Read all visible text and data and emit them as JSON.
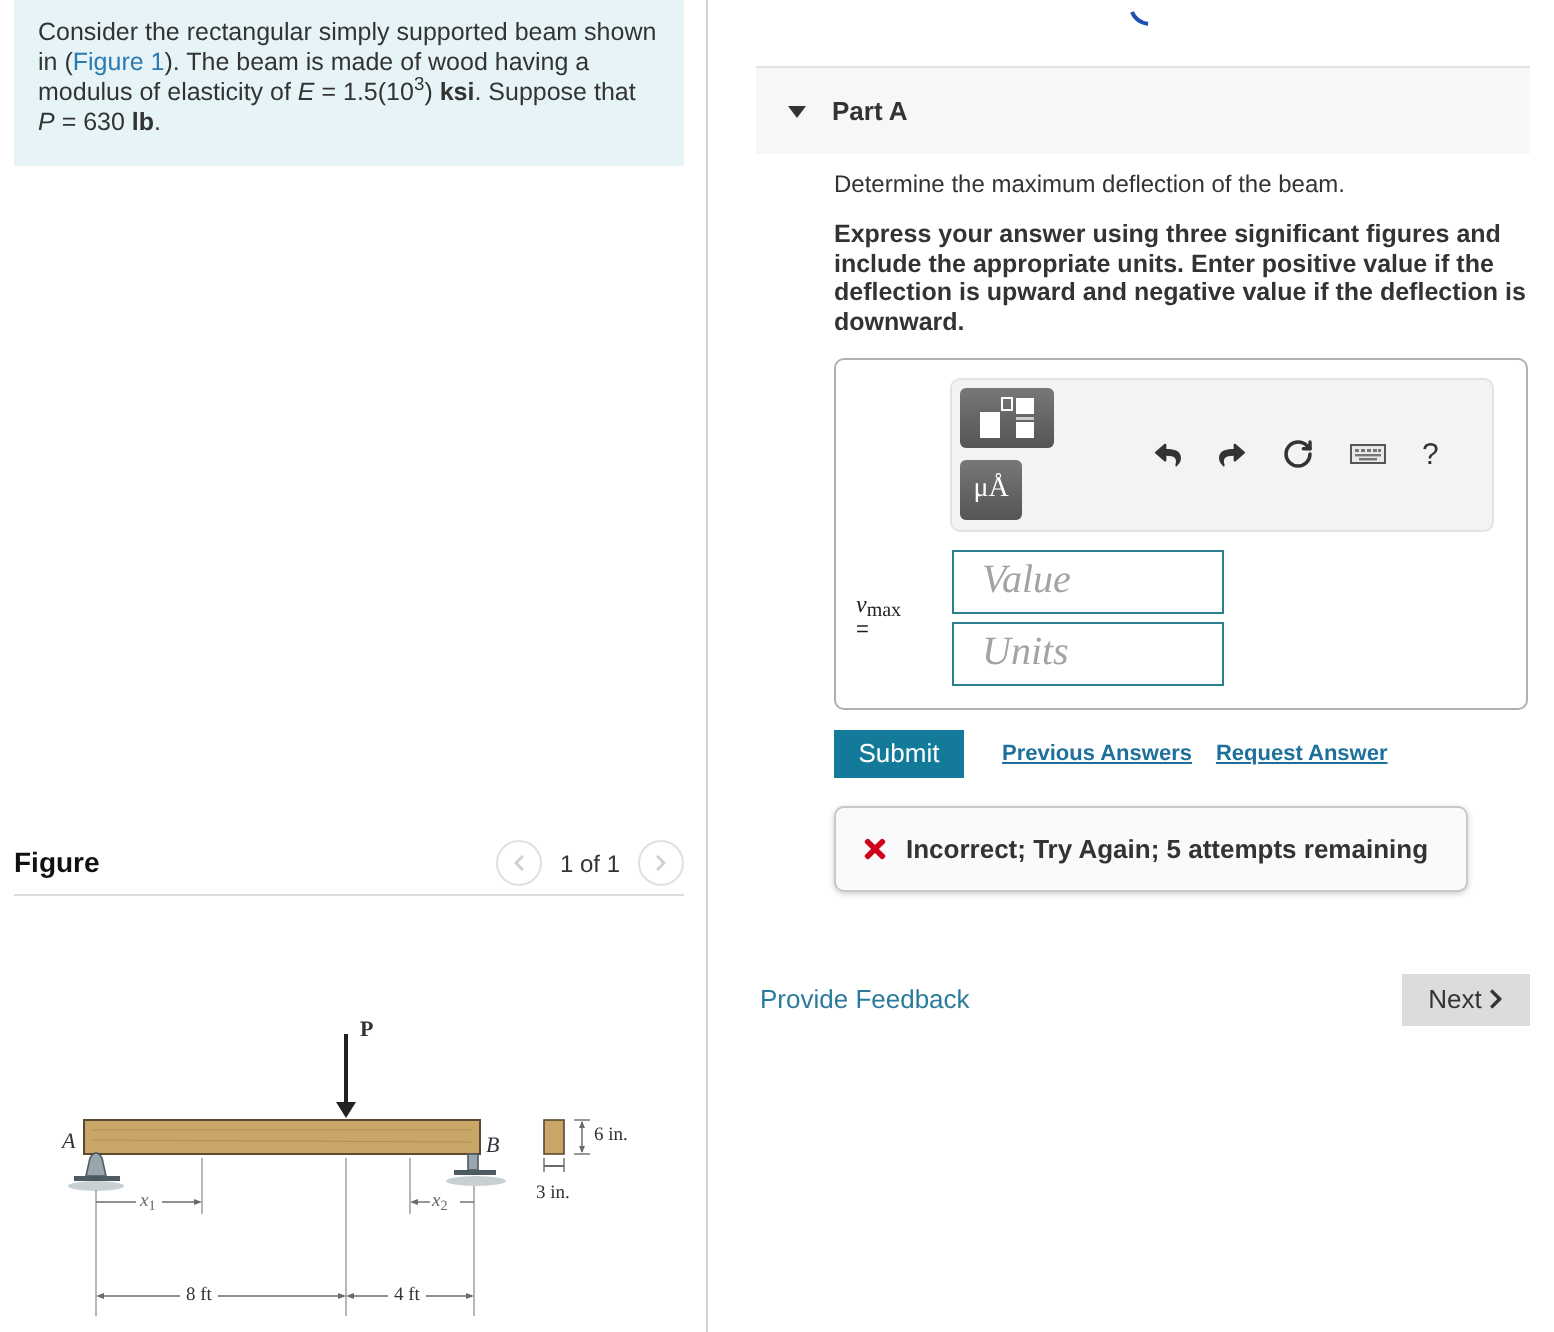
{
  "problem": {
    "text_before": "Consider the rectangular simply supported beam shown in (",
    "link": "Figure 1",
    "text_after": "). The beam is made of wood having a modulus of elasticity of *E* = 1.5(10$^{3}$) **ksi**. Suppose that *P* = 630 **lb**."
  },
  "figure": {
    "title": "Figure",
    "pager": {
      "label": "1 of 1",
      "prev_disabled": true,
      "next_disabled": true
    },
    "labels": [
      {
        "text": "P"
      },
      {
        "text": "A"
      },
      {
        "text": "B"
      },
      {
        "text": "6 in."
      },
      {
        "text": "3 in."
      },
      {
        "text": "*x*$_{1}$"
      },
      {
        "text": "*x*$_{2}$"
      },
      {
        "text": "8 ft"
      },
      {
        "text": "4 ft"
      }
    ]
  },
  "part": {
    "title": "Part A",
    "expanded": true,
    "prompt": "Determine the maximum deflection of the beam.",
    "instructions": "Express your answer using three significant figures and include the appropriate units. Enter positive value if the deflection is upward and negative value if the deflection is downward."
  },
  "answer": {
    "variable": "*v*$_{max}$",
    "equals": "=",
    "unit_button": "μÅ",
    "help": "?",
    "fields": [
      {
        "placeholder": "Value"
      },
      {
        "placeholder": "Units"
      }
    ],
    "submit": "Submit",
    "links": [
      "Previous Answers",
      "Request Answer"
    ]
  },
  "feedback": {
    "kind": "incorrect",
    "message": "Incorrect; Try Again; 5 attempts remaining"
  },
  "footer": {
    "feedback_link": "Provide Feedback",
    "next": "Next"
  }
}
